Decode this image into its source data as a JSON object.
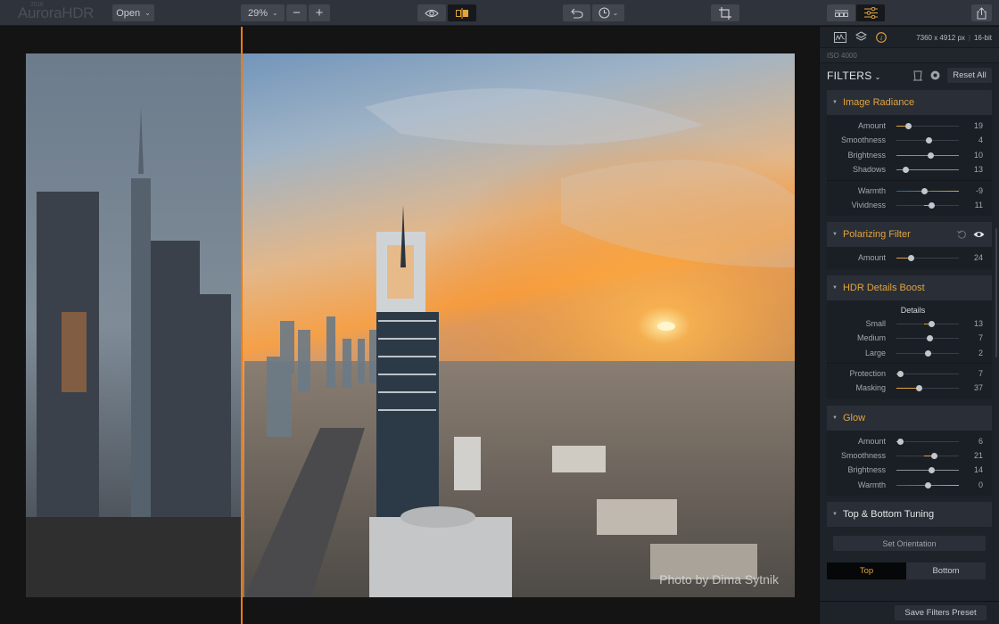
{
  "app": {
    "logo_text": "AuroraHDR",
    "logo_year": "2018"
  },
  "toolbar": {
    "open_label": "Open",
    "zoom_value": "29%",
    "zoom_out_label": "−",
    "zoom_in_label": "+",
    "preview_icon": "eye-icon",
    "compare_icon": "split-compare-icon",
    "undo_icon": "undo-icon",
    "history_icon": "clock-icon",
    "crop_icon": "crop-icon",
    "presets_icon": "presets-icon",
    "filters_icon": "sliders-icon",
    "share_icon": "share-icon"
  },
  "canvas": {
    "photo_credit": "Photo by Dima Sytnik",
    "split_color": "#f07a12"
  },
  "panel": {
    "tabs": [
      "histogram-icon",
      "layers-icon",
      "info-icon"
    ],
    "dimensions": "7360 x 4912 px",
    "bit_depth": "16-bit",
    "iso": "ISO 4000",
    "filters_title": "FILTERS",
    "reset_all_label": "Reset All",
    "accent_color": "#e2a33b",
    "sections": {
      "image_radiance": {
        "title": "Image Radiance",
        "sliders": [
          {
            "label": "Amount",
            "value": "19",
            "pos": 0.19,
            "fill_from": 0
          },
          {
            "label": "Smoothness",
            "value": "4",
            "pos": 0.52
          },
          {
            "label": "Brightness",
            "value": "10",
            "pos": 0.55
          },
          {
            "label": "Shadows",
            "value": "13",
            "pos": 0.15
          }
        ],
        "sliders2": [
          {
            "label": "Warmth",
            "value": "-9",
            "pos": 0.45
          },
          {
            "label": "Vividness",
            "value": "11",
            "pos": 0.56
          }
        ]
      },
      "polarizing_filter": {
        "title": "Polarizing Filter",
        "sliders": [
          {
            "label": "Amount",
            "value": "24",
            "pos": 0.24
          }
        ]
      },
      "hdr_details_boost": {
        "title": "HDR Details Boost",
        "subheading": "Details",
        "sliders": [
          {
            "label": "Small",
            "value": "13",
            "pos": 0.57
          },
          {
            "label": "Medium",
            "value": "7",
            "pos": 0.54
          },
          {
            "label": "Large",
            "value": "2",
            "pos": 0.51
          }
        ],
        "sliders2": [
          {
            "label": "Protection",
            "value": "7",
            "pos": 0.07
          },
          {
            "label": "Masking",
            "value": "37",
            "pos": 0.37
          }
        ]
      },
      "glow": {
        "title": "Glow",
        "sliders": [
          {
            "label": "Amount",
            "value": "6",
            "pos": 0.06
          },
          {
            "label": "Smoothness",
            "value": "21",
            "pos": 0.6
          },
          {
            "label": "Brightness",
            "value": "14",
            "pos": 0.57
          },
          {
            "label": "Warmth",
            "value": "0",
            "pos": 0.5
          }
        ]
      },
      "top_bottom_tuning": {
        "title": "Top & Bottom Tuning",
        "set_orientation_label": "Set Orientation",
        "top_label": "Top",
        "bottom_label": "Bottom",
        "selected": "Top"
      }
    },
    "save_preset_label": "Save Filters Preset"
  }
}
